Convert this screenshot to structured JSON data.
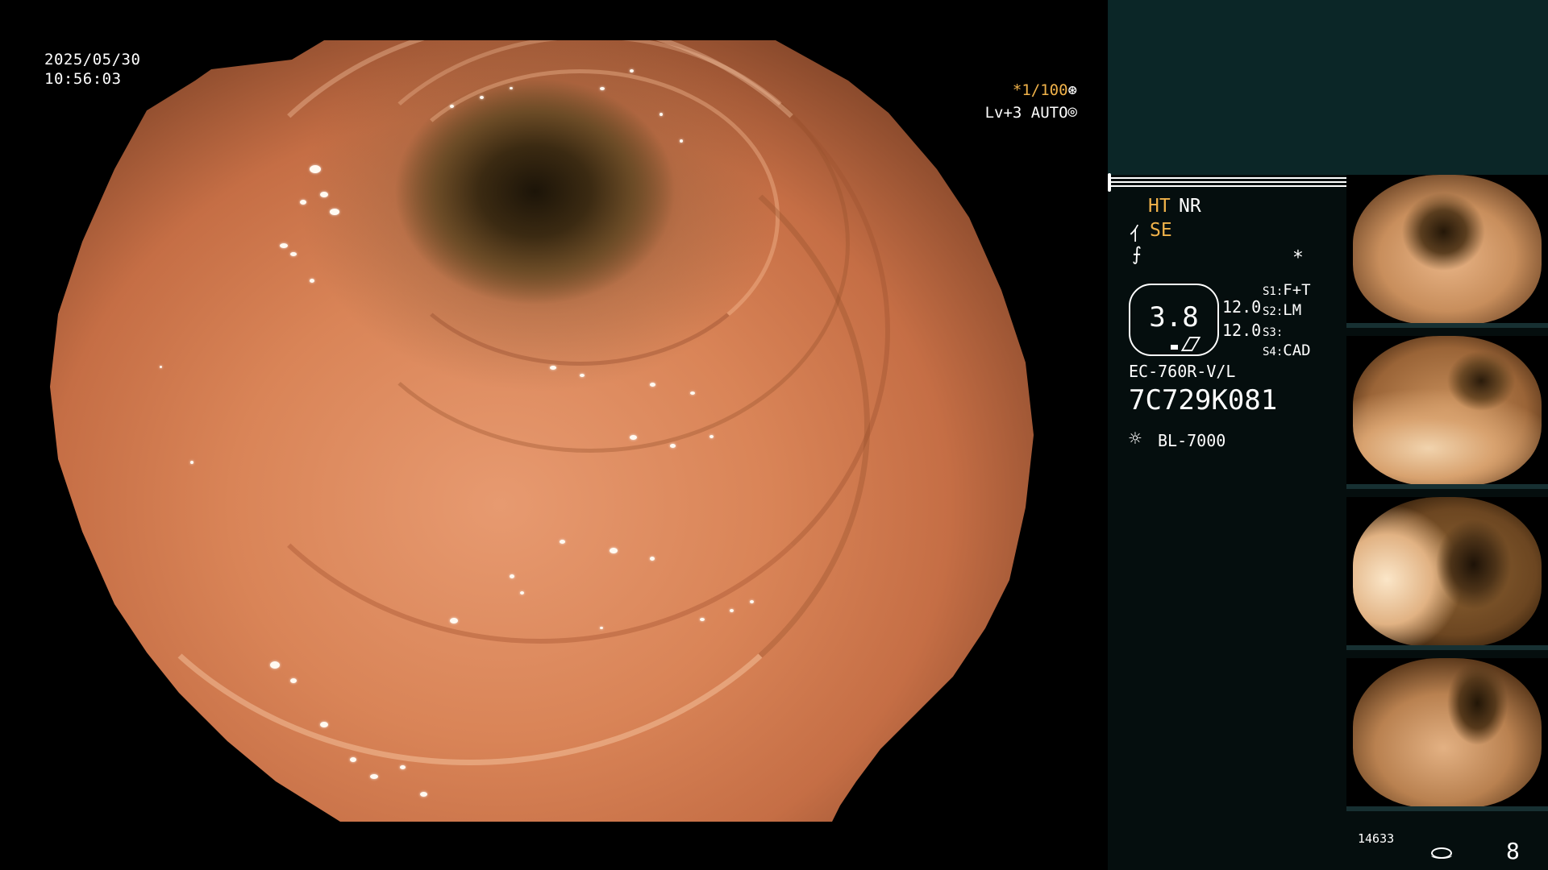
{
  "osd": {
    "date": "2025/05/30",
    "time": "10:56:03",
    "shutter": "*1/100",
    "shutter_icon": "shutter-wheel-icon",
    "level": "Lv+3",
    "iris": "AUTO",
    "iris_icon": "iris-icon"
  },
  "panel": {
    "mode_ht": "HT",
    "mode_nr": "NR",
    "mode_se_icon": "⺅",
    "mode_se": "SE",
    "enhance_icon": "⨍",
    "asterisk": "*",
    "zoom_value": "3.8",
    "value_1": "12.0",
    "value_2": "12.0",
    "slots": [
      {
        "key": "S1:",
        "value": "F+T"
      },
      {
        "key": "S2:",
        "value": "LM"
      },
      {
        "key": "S3:",
        "value": ""
      },
      {
        "key": "S4:",
        "value": "CAD"
      }
    ],
    "scope_model": "EC-760R-V/L",
    "scope_serial": "7C729K081",
    "light_icon": "☼",
    "light_model": "BL-7000",
    "frame_counter": "14633",
    "page_number": "8"
  },
  "colors": {
    "panel_top": "#0b2627",
    "panel_bg": "#050e0e",
    "accent_orange": "#f0b24a"
  }
}
